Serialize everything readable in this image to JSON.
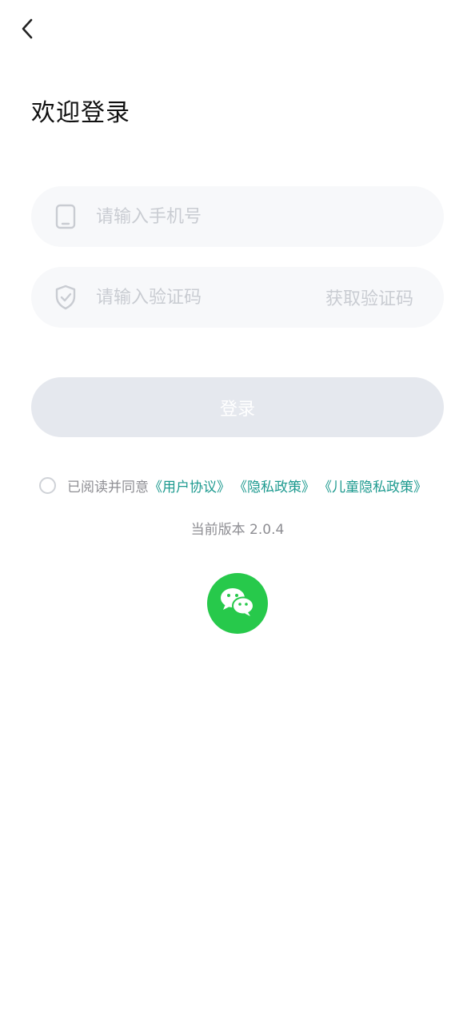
{
  "header": {
    "back_icon": "chevron-left-icon"
  },
  "page": {
    "title": "欢迎登录"
  },
  "form": {
    "phone": {
      "placeholder": "请输入手机号",
      "value": "",
      "icon": "phone-icon"
    },
    "code": {
      "placeholder": "请输入验证码",
      "value": "",
      "icon": "shield-check-icon",
      "get_code_label": "获取验证码"
    },
    "login_label": "登录"
  },
  "agreement": {
    "checked": false,
    "prefix": "已阅读并同意",
    "links": [
      "《用户协议》",
      "《隐私政策》",
      "《儿童隐私政策》"
    ],
    "link_color": "#1d9a8f"
  },
  "version_text": "当前版本 2.0.4",
  "third_party": {
    "wechat_icon": "wechat-icon",
    "wechat_color": "#27c94b"
  },
  "colors": {
    "field_bg": "#f7f8fa",
    "placeholder": "#c9ccd2",
    "login_disabled_bg": "#e5e8ee"
  }
}
